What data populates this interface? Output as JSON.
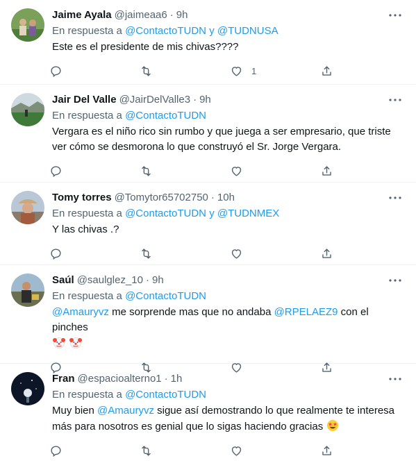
{
  "colors": {
    "link": "#1d9bf0",
    "secondary": "#536471",
    "text": "#0f1419",
    "divider": "#eff3f4"
  },
  "tweets": [
    {
      "name": "Jaime Ayala",
      "handle": "@jaimeaa6",
      "dot": "·",
      "time": "9h",
      "reply_prefix": "En respuesta a",
      "reply_mentions": [
        "@ContactoTUDN",
        "y",
        "@TUDNUSA"
      ],
      "text": "Este es el presidente de mis chivas????",
      "like_count": "1"
    },
    {
      "name": "Jair Del Valle",
      "handle": "@JairDelValle3",
      "dot": "·",
      "time": "9h",
      "reply_prefix": "En respuesta a",
      "reply_mentions": [
        "@ContactoTUDN"
      ],
      "text": "Vergara es el niño rico sin rumbo y que juega a ser empresario, que triste ver cómo se desmorona lo que construyó el Sr. Jorge Vergara."
    },
    {
      "name": "Tomy torres",
      "handle": "@Tomytor65702750",
      "dot": "·",
      "time": "10h",
      "reply_prefix": "En respuesta a",
      "reply_mentions": [
        "@ContactoTUDN",
        "y",
        "@TUDNMEX"
      ],
      "text": "Y las chivas .?"
    },
    {
      "name": "Saúl",
      "handle": "@saulglez_10",
      "dot": "·",
      "time": "9h",
      "reply_prefix": "En respuesta a",
      "reply_mentions": [
        "@ContactoTUDN"
      ],
      "text_parts": {
        "mention1": "@Amauryvz",
        "mid": " me sorprende mas que no andaba ",
        "mention2": "@RPELAEZ9",
        "end": " con el pinches"
      },
      "emojis": [
        "clown-face",
        "clown-face"
      ]
    },
    {
      "name": "Fran",
      "handle": "@espacioalterno1",
      "dot": "·",
      "time": "1h",
      "reply_prefix": "En respuesta a",
      "reply_mentions": [
        "@ContactoTUDN"
      ],
      "text_parts": {
        "start": "Muy bien ",
        "mention1": "@Amauryvz",
        "end": " sigue así demostrando lo que realmente te interesa más para nosotros es genial que lo sigas haciendo gracias"
      },
      "emojis": [
        "star-struck"
      ]
    }
  ]
}
